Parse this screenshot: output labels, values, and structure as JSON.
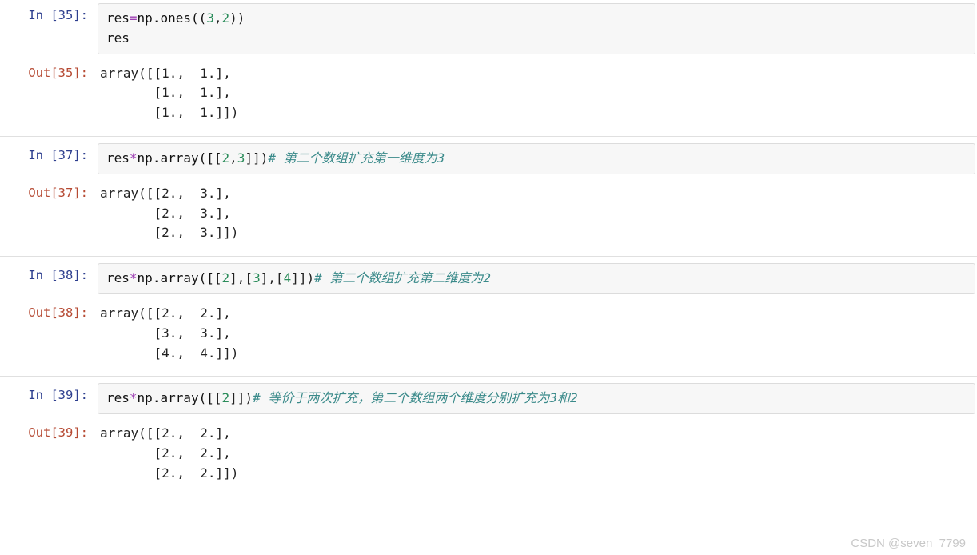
{
  "cells": [
    {
      "in_prompt": "In  [35]:",
      "out_prompt": "Out[35]:",
      "code": {
        "line1_a": "res",
        "line1_op_eq": "=",
        "line1_b": "np.ones((",
        "line1_n1": "3",
        "line1_c": ",",
        "line1_n2": "2",
        "line1_d": "))",
        "line2": "res"
      },
      "output": "array([[1.,  1.],\n       [1.,  1.],\n       [1.,  1.]])"
    },
    {
      "in_prompt": "In  [37]:",
      "out_prompt": "Out[37]:",
      "code": {
        "a": "res",
        "op_mul": "*",
        "b": "np.array([[",
        "n1": "2",
        "c": ",",
        "n2": "3",
        "d": "]])",
        "comment": "# 第二个数组扩充第一维度为3"
      },
      "output": "array([[2.,  3.],\n       [2.,  3.],\n       [2.,  3.]])"
    },
    {
      "in_prompt": "In  [38]:",
      "out_prompt": "Out[38]:",
      "code": {
        "a": "res",
        "op_mul": "*",
        "b": "np.array([[",
        "n1": "2",
        "c1": "],[",
        "n2": "3",
        "c2": "],[",
        "n3": "4",
        "d": "]])",
        "comment": "# 第二个数组扩充第二维度为2"
      },
      "output": "array([[2.,  2.],\n       [3.,  3.],\n       [4.,  4.]])"
    },
    {
      "in_prompt": "In  [39]:",
      "out_prompt": "Out[39]:",
      "code": {
        "a": "res",
        "op_mul": "*",
        "b": "np.array([[",
        "n1": "2",
        "d": "]])",
        "comment": "# 等价于两次扩充，第二个数组两个维度分别扩充为3和2"
      },
      "output": "array([[2.,  2.],\n       [2.,  2.],\n       [2.,  2.]])"
    }
  ],
  "watermark": "CSDN @seven_7799"
}
